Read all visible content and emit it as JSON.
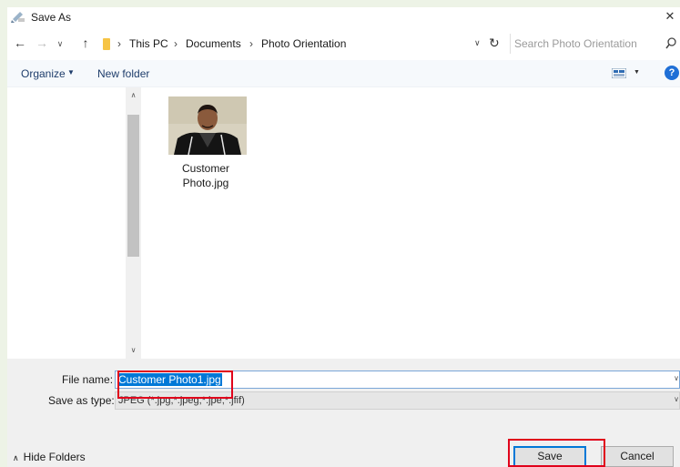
{
  "window": {
    "title": "Save As",
    "close_label": "✕"
  },
  "addressbar": {
    "breadcrumbs": [
      "This PC",
      "Documents",
      "Photo Orientation"
    ],
    "separator": "›"
  },
  "search": {
    "placeholder": "Search Photo Orientation"
  },
  "toolbar": {
    "organize_label": "Organize",
    "new_folder_label": "New folder",
    "help_label": "?"
  },
  "files": [
    {
      "name_line1": "Customer",
      "name_line2": "Photo.jpg"
    }
  ],
  "form": {
    "file_name_label": "File name:",
    "file_name_value": "Customer Photo1.jpg",
    "save_as_type_label": "Save as type:",
    "save_as_type_value": "JPEG (*.jpg;*.jpeg;*.jpe;*.jfif)"
  },
  "footer": {
    "hide_folders_label": "Hide Folders",
    "save_label": "Save",
    "cancel_label": "Cancel"
  },
  "colors": {
    "accent": "#0078d7",
    "annotation": "#e0001b",
    "help_icon": "#1f6fd6",
    "folder_icon": "#f6c445"
  },
  "icons": [
    "save-as-icon",
    "close-icon",
    "back-arrow-icon",
    "forward-arrow-icon",
    "recent-locations-icon",
    "up-arrow-icon",
    "folder-icon",
    "chevron-down-icon",
    "refresh-icon",
    "search-icon",
    "view-options-icon",
    "help-icon",
    "chevron-up-icon"
  ]
}
